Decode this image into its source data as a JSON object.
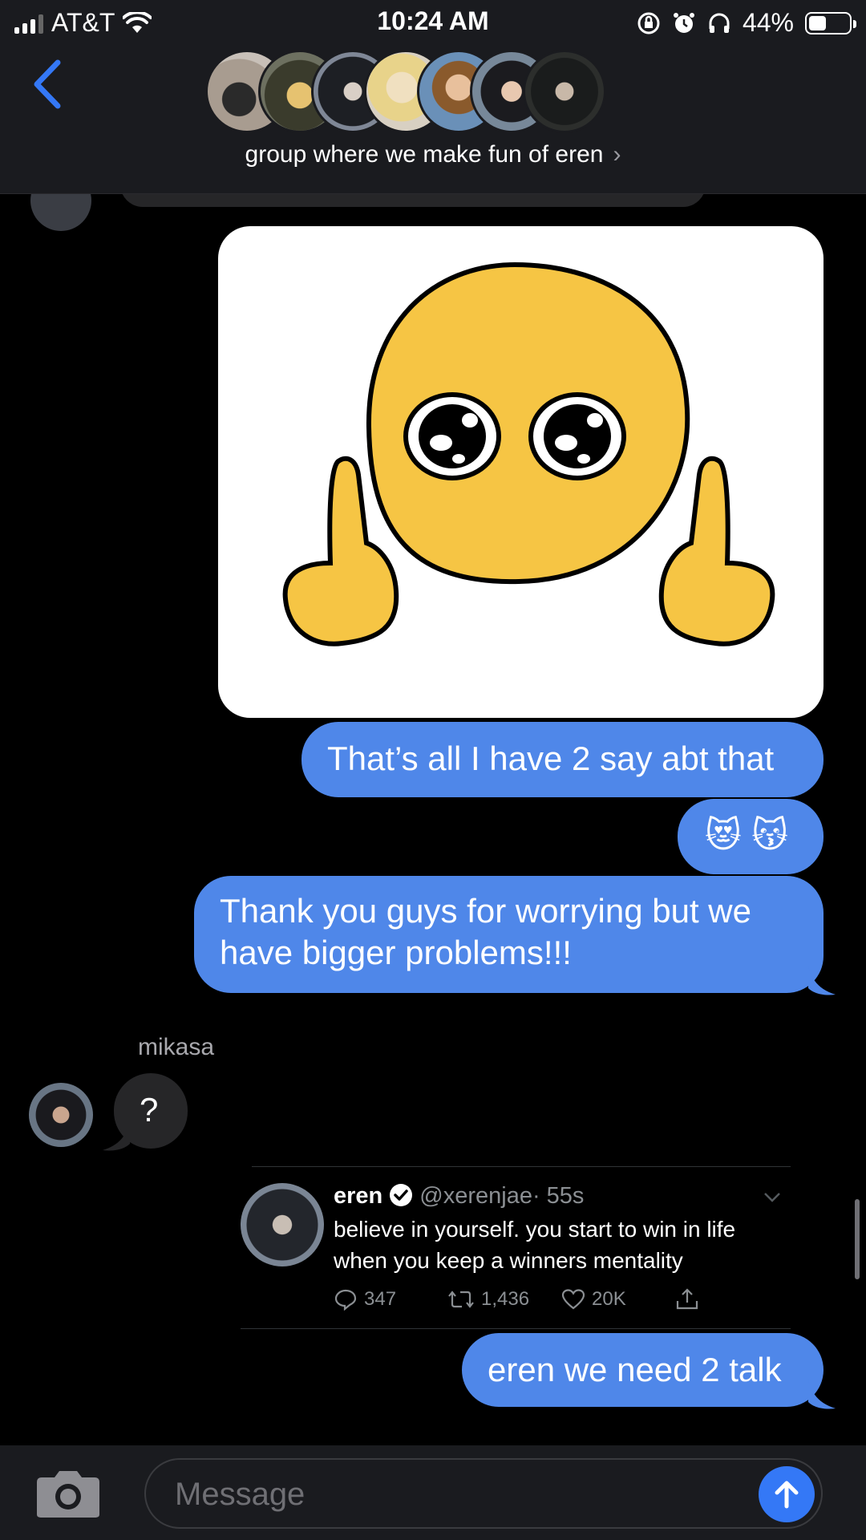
{
  "status_bar": {
    "carrier": "AT&T",
    "time": "10:24 AM",
    "battery": "44%",
    "battery_level": 0.44,
    "icons": [
      "signal-icon",
      "wifi-icon",
      "rotation-lock-icon",
      "alarm-icon",
      "headphones-icon",
      "battery-icon"
    ]
  },
  "header": {
    "title": "group where we make fun of eren",
    "back_icon": "chevron-left-icon",
    "title_chevron": "›"
  },
  "messages": {
    "outgoing_1": "That’s all I have 2 say abt that",
    "outgoing_2": "😻 😽",
    "outgoing_3_line1": "Thank you guys for worrying but we",
    "outgoing_3_line2": "have bigger problems!!!",
    "sender_name": "mikasa",
    "incoming_1": "?",
    "outgoing_4": "eren we need 2 talk"
  },
  "tweet": {
    "name": "eren",
    "handle": "@xerenjae",
    "time": "· 55s",
    "text": "believe in yourself. you start to win in life when you keep a winners mentality",
    "replies": "347",
    "retweets": "1,436",
    "likes": "20K"
  },
  "compose": {
    "placeholder": "Message"
  },
  "colors": {
    "outgoing_bubble": "#4f87e9",
    "incoming_bubble": "#262628",
    "accent": "#3478f6",
    "emoji_yellow": "#f6c544"
  }
}
